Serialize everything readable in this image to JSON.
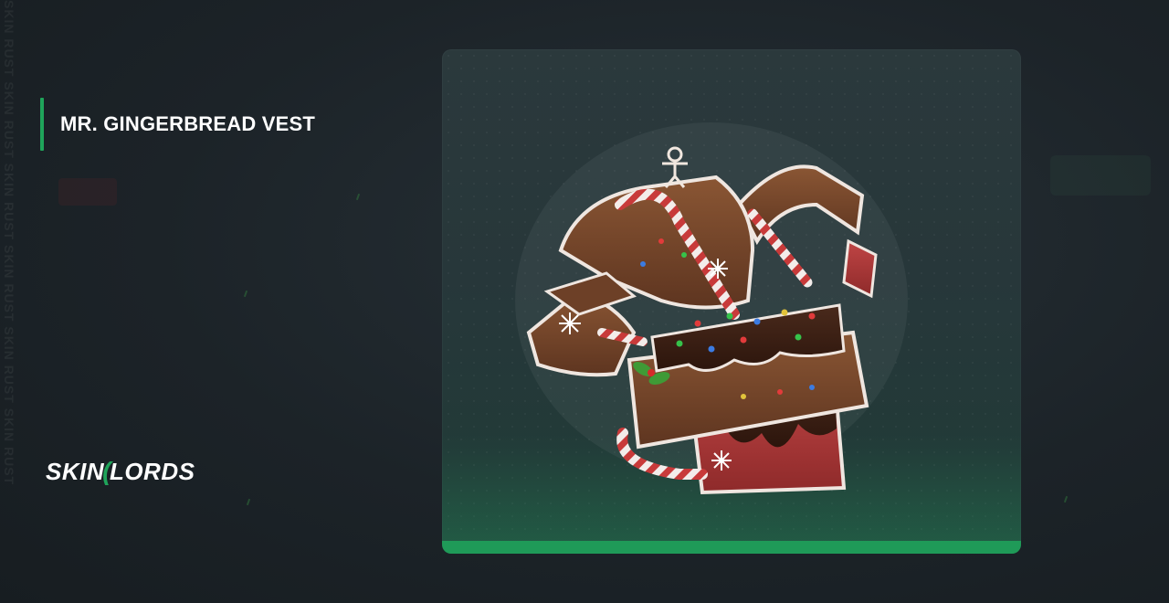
{
  "item": {
    "title": "MR. GINGERBREAD VEST"
  },
  "brand": {
    "logo_left": "SKIN",
    "logo_right": "LORDS",
    "accent_color": "#1fa45a"
  },
  "watermark": {
    "text": "SKIN RUST SKIN RUST SKIN RUST SKIN RUST SKIN RUST SKIN RUST"
  },
  "icons": [
    "gingerbread-vest-image",
    "skinlords-logo"
  ]
}
